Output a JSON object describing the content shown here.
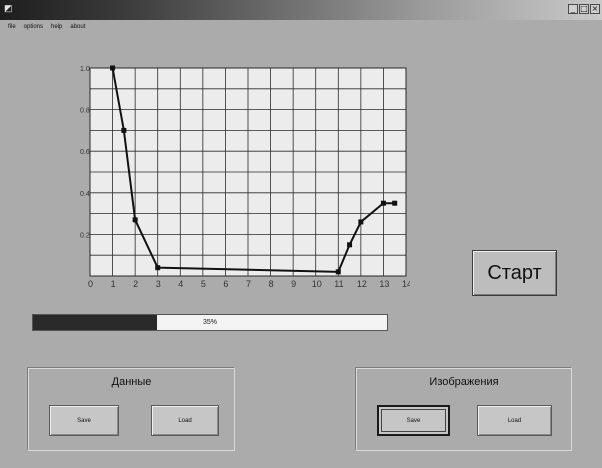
{
  "menu": {
    "items": [
      "file",
      "options",
      "help",
      "about"
    ]
  },
  "window_controls": [
    "_",
    "□",
    "×"
  ],
  "chart_data": {
    "type": "line",
    "x": [
      1,
      1.5,
      2,
      3,
      11,
      11.5,
      12,
      13,
      13.5
    ],
    "y": [
      1.0,
      0.7,
      0.27,
      0.04,
      0.02,
      0.15,
      0.26,
      0.35,
      0.35
    ],
    "xlim": [
      0,
      14
    ],
    "ylim": [
      0,
      1.0
    ],
    "x_ticks": [
      "0",
      "1",
      "2",
      "3",
      "4",
      "5",
      "6",
      "7",
      "8",
      "9",
      "10",
      "11",
      "12",
      "13",
      "14"
    ],
    "y_ticks": [
      "0.2",
      "0.4",
      "0.6",
      "0.8",
      "1.0"
    ],
    "grid": true,
    "marker": "square",
    "colors": {
      "line": "#111111",
      "grid": "#2a2a2a",
      "plot_bg": "#ececec"
    }
  },
  "start_button": {
    "label": "Старт"
  },
  "progress": {
    "value": 0.35,
    "label": "35%"
  },
  "groups": {
    "data": {
      "title": "Данные",
      "save_label": "Save",
      "load_label": "Load"
    },
    "images": {
      "title": "Изображения",
      "save_label": "Save",
      "load_label": "Load"
    }
  }
}
